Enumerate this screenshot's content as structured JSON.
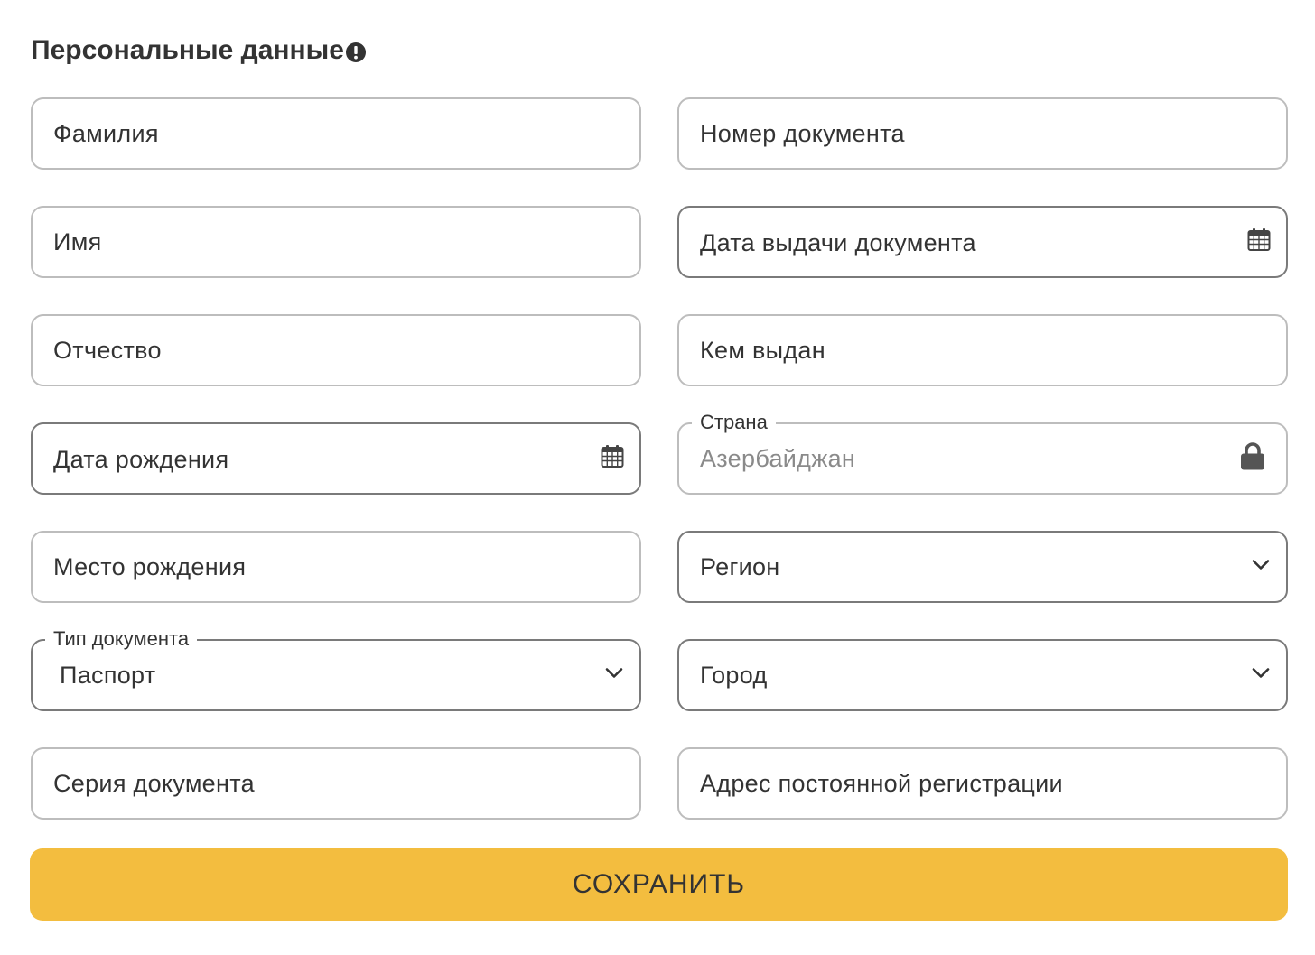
{
  "section": {
    "title": "Персональные данные"
  },
  "left_fields": {
    "last_name": "Фамилия",
    "first_name": "Имя",
    "patronymic": "Отчество",
    "birth_date": "Дата рождения",
    "birth_place": "Место рождения",
    "document_type_label": "Тип документа",
    "document_type_value": "Паспорт",
    "document_series": "Серия документа"
  },
  "right_fields": {
    "document_number": "Номер документа",
    "issue_date": "Дата выдачи документа",
    "issued_by": "Кем выдан",
    "country_label": "Страна",
    "country_value": "Азербайджан",
    "region": "Регион",
    "city": "Город",
    "registration_address": "Адрес постоянной регистрации"
  },
  "actions": {
    "save_label": "СОХРАНИТЬ"
  },
  "icons": {
    "title_info": "info-circle-icon",
    "calendar": "calendar-icon",
    "lock": "lock-icon",
    "chevron": "chevron-down-icon"
  },
  "colors": {
    "button_bg": "#f3bd3f",
    "text": "#333333",
    "border": "#bdbdbd",
    "disabled_text": "#8a8a8a"
  }
}
